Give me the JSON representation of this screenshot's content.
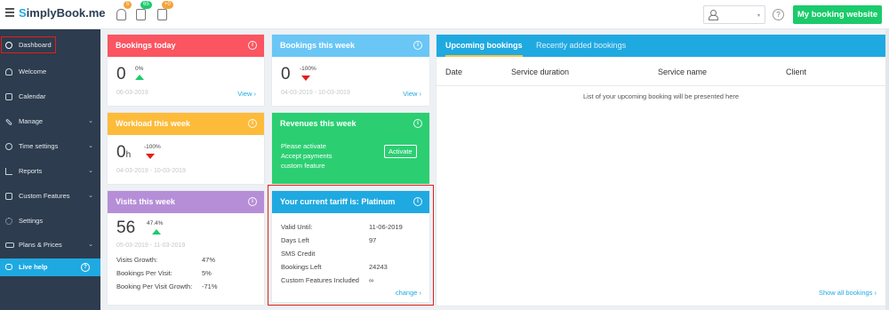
{
  "app": {
    "logo_text": "SimplyBook.me",
    "brand_color": "#1fa9e1",
    "accent_green": "#1bcb6b"
  },
  "topbar": {
    "icons": [
      {
        "name": "bell-icon",
        "badge": "5",
        "badge_color": "#f3a33a"
      },
      {
        "name": "calendar-check-icon",
        "badge": "65",
        "badge_color": "#1bcb6b"
      },
      {
        "name": "calendar-icon",
        "badge": "+0",
        "badge_color": "#f3a33a"
      }
    ],
    "user_select_caret": "▾",
    "help_glyph": "?",
    "booking_website_button": "My booking website"
  },
  "sidebar": {
    "items": [
      {
        "label": "Dashboard",
        "icon": "dashboard-icon",
        "chevron": ""
      },
      {
        "label": "Welcome",
        "icon": "lightbulb-icon",
        "chevron": ""
      },
      {
        "label": "Calendar",
        "icon": "calendar-icon",
        "chevron": ""
      },
      {
        "label": "Manage",
        "icon": "pencil-icon",
        "chevron": "⌄"
      },
      {
        "label": "Time settings",
        "icon": "clock-icon",
        "chevron": "⌄"
      },
      {
        "label": "Reports",
        "icon": "chart-icon",
        "chevron": "⌄"
      },
      {
        "label": "Custom Features",
        "icon": "gift-icon",
        "chevron": "⌄"
      },
      {
        "label": "Settings",
        "icon": "gear-icon",
        "chevron": ""
      },
      {
        "label": "Plans & Prices",
        "icon": "money-icon",
        "chevron": "⌄"
      }
    ],
    "live_help": {
      "label": "Live help",
      "icon": "chat-icon",
      "help_glyph": "?"
    }
  },
  "cards": {
    "bookings_today": {
      "title": "Bookings today",
      "info": "i",
      "color": "#fa5560",
      "value": "0",
      "pct": "0%",
      "trend": "up",
      "date": "06-03-2019",
      "link": "View  ›"
    },
    "bookings_week": {
      "title": "Bookings this week",
      "info": "i",
      "color": "#6ac6f5",
      "value": "0",
      "pct": "-100%",
      "trend": "down",
      "date": "04-03-2019 - 10-03-2019",
      "link": "View  ›"
    },
    "workload_week": {
      "title": "Workload this week",
      "info": "i",
      "color": "#fdbb3a",
      "value": "0",
      "unit": "h",
      "pct": "-100%",
      "trend": "down",
      "date": "04-03-2019 - 10-03-2019"
    },
    "revenues_week": {
      "title": "Revenues this week",
      "info": "i",
      "color": "#2bcf72",
      "lines": [
        "Please activate",
        "Accept payments",
        "custom feature"
      ],
      "button": "Activate"
    },
    "visits_week": {
      "title": "Visits this week",
      "info": "i",
      "color": "#b68ed8",
      "value": "56",
      "pct": "47.4%",
      "trend": "up",
      "date": "05-03-2019 - 11-03-2019",
      "stats": [
        {
          "label": "Visits Growth:",
          "value": "47%"
        },
        {
          "label": "Bookings Per Visit:",
          "value": "5%"
        },
        {
          "label": "Booking Per Visit Growth:",
          "value": "-71%"
        }
      ]
    },
    "tariff": {
      "title": "Your current tariff is: Platinum",
      "info": "i",
      "color": "#1fa9e1",
      "rows": [
        {
          "label": "Valid Until:",
          "value": "11-06-2019"
        },
        {
          "label": "Days Left",
          "value": "97"
        },
        {
          "label": "SMS Credit",
          "value": ""
        },
        {
          "label": "Bookings Left",
          "value": "24243"
        },
        {
          "label": "Custom Features Included",
          "value": "∞"
        }
      ],
      "link": "change  ›"
    }
  },
  "bookings_panel": {
    "tabs": [
      {
        "label": "Upcoming bookings",
        "active": true
      },
      {
        "label": "Recently added bookings",
        "active": false
      }
    ],
    "columns": [
      "Date",
      "Service duration",
      "Service name",
      "Client"
    ],
    "empty_text": "List of your upcoming booking will be presented here",
    "show_all": "Show all bookings  ›"
  }
}
